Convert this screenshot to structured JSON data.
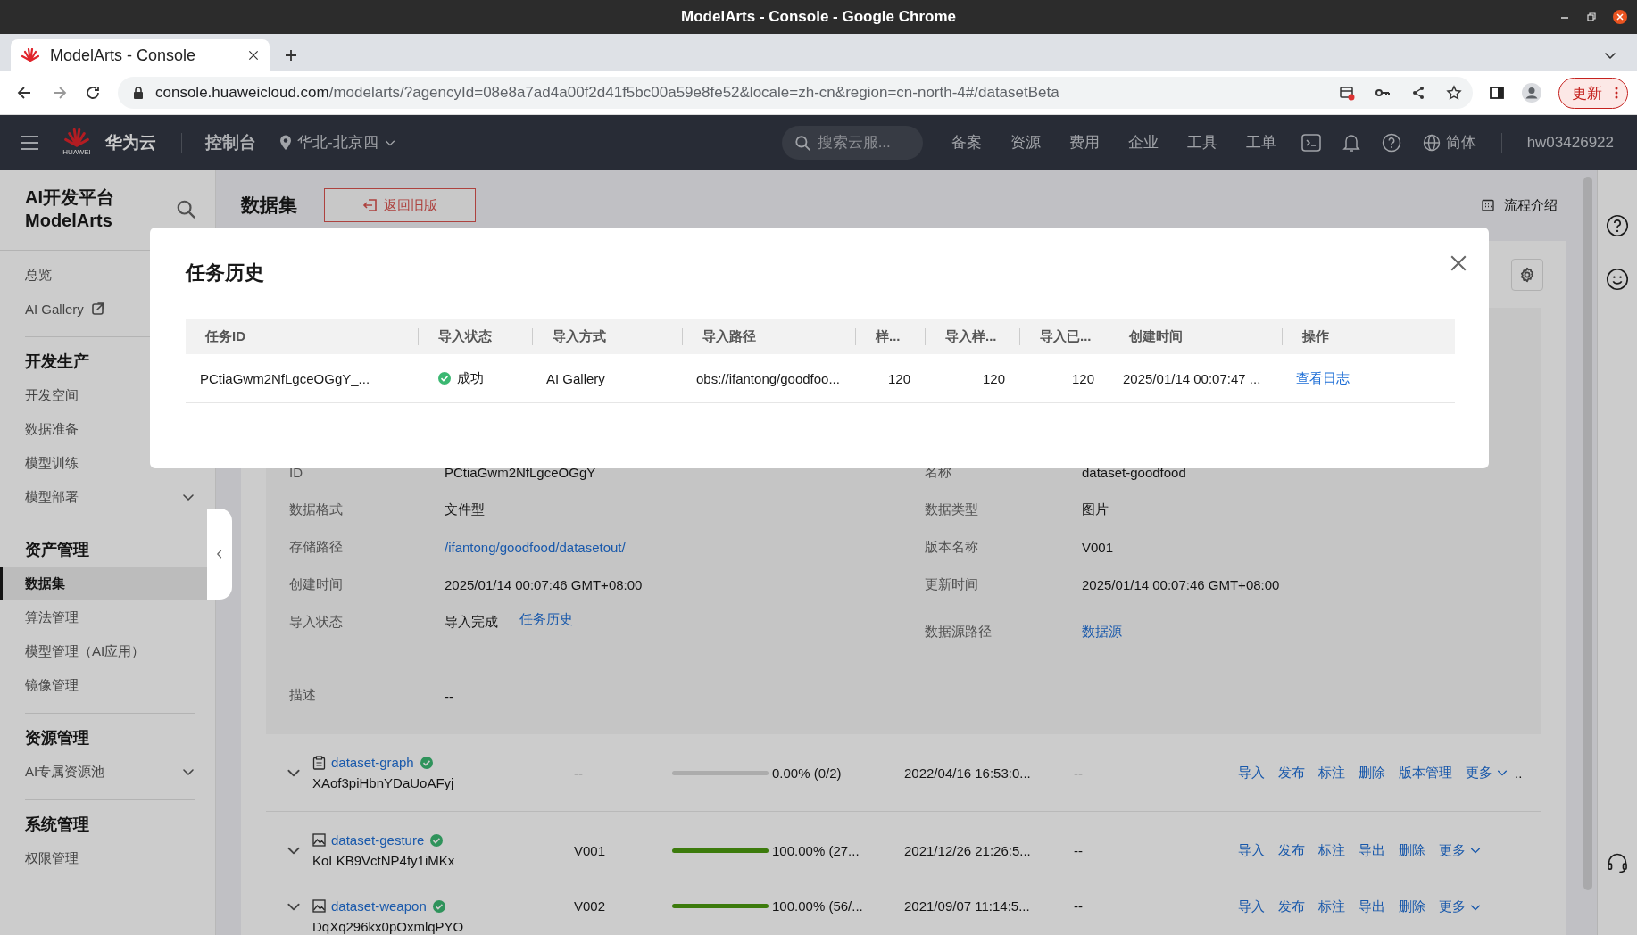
{
  "browser": {
    "title": "ModelArts - Console - Google Chrome",
    "tab_title": "ModelArts - Console",
    "url_host": "console.huaweicloud.com",
    "url_path": "/modelarts/?agencyId=08e8a7ad4a00f2d41f5bc00a59e8fe52&locale=zh-cn&region=cn-north-4#/datasetBeta",
    "update_button": "更新"
  },
  "header": {
    "logo_text": "HUAWEI",
    "brand": "华为云",
    "console": "控制台",
    "region": "华北-北京四",
    "search": {
      "placeholder": "搜索云服..."
    },
    "nav": [
      "备案",
      "资源",
      "费用",
      "企业",
      "工具",
      "工单"
    ],
    "language": "简体",
    "user": "hw03426922"
  },
  "sidebar": {
    "title": [
      "AI开发平台",
      "ModelArts"
    ],
    "groups": [
      {
        "items": [
          {
            "label": "总览",
            "kind": "item",
            "selected": false
          },
          {
            "label": "AI Gallery",
            "kind": "external",
            "selected": false
          }
        ]
      },
      {
        "heading": "开发生产",
        "items": [
          {
            "label": "开发空间",
            "kind": "item",
            "selected": false
          },
          {
            "label": "数据准备",
            "kind": "item",
            "selected": false
          },
          {
            "label": "模型训练",
            "kind": "item",
            "selected": false
          },
          {
            "label": "模型部署",
            "kind": "expandable",
            "selected": false
          }
        ]
      },
      {
        "heading": "资产管理",
        "items": [
          {
            "label": "数据集",
            "kind": "item",
            "selected": true
          },
          {
            "label": "算法管理",
            "kind": "item",
            "selected": false
          },
          {
            "label": "模型管理（AI应用）",
            "kind": "item",
            "selected": false
          },
          {
            "label": "镜像管理",
            "kind": "item",
            "selected": false
          }
        ]
      },
      {
        "heading": "资源管理",
        "items": [
          {
            "label": "AI专属资源池",
            "kind": "expandable",
            "selected": false
          }
        ]
      },
      {
        "heading": "系统管理",
        "items": [
          {
            "label": "权限管理",
            "kind": "item",
            "selected": false
          }
        ]
      }
    ]
  },
  "page": {
    "title": "数据集",
    "back_button": "返回旧版",
    "intro_link": "流程介绍"
  },
  "details": [
    [
      {
        "label": "ID",
        "value": "PCtiaGwm2NfLgceOGgY",
        "kind": "text"
      },
      {
        "label": "名称",
        "value": "dataset-goodfood",
        "kind": "text"
      }
    ],
    [
      {
        "label": "数据格式",
        "value": "文件型",
        "kind": "text"
      },
      {
        "label": "数据类型",
        "value": "图片",
        "kind": "text"
      }
    ],
    [
      {
        "label": "存储路径",
        "value": "/ifantong/goodfood/datasetout/",
        "kind": "link"
      },
      {
        "label": "版本名称",
        "value": "V001",
        "kind": "text"
      }
    ],
    [
      {
        "label": "创建时间",
        "value": "2025/01/14 00:07:46 GMT+08:00",
        "kind": "text"
      },
      {
        "label": "更新时间",
        "value": "2025/01/14 00:07:46 GMT+08:00",
        "kind": "text"
      }
    ],
    [
      {
        "label": "导入状态",
        "value": "导入完成",
        "link": "任务历史",
        "kind": "text"
      },
      {
        "label": "数据源路径",
        "value": "数据源",
        "kind": "link"
      }
    ],
    [
      {
        "label": "描述",
        "value": "--",
        "kind": "text"
      }
    ]
  ],
  "datasets": [
    {
      "name": "dataset-graph",
      "kind": "table",
      "id": "XAof3piHbnYDaUoAFyj",
      "version": "--",
      "level": 0,
      "progress": "0.00% (0/2)",
      "time": "2022/04/16 16:53:0...",
      "column_5": "--",
      "actions": [
        "导入",
        "发布",
        "标注",
        "删除",
        "版本管理"
      ],
      "more": "更多",
      "overflow": ".."
    },
    {
      "name": "dataset-gesture",
      "kind": "image",
      "id": "KoLKB9VctNP4fy1iMKx",
      "version": "V001",
      "level": 1,
      "progress": "100.00% (27...",
      "time": "2021/12/26 21:26:5...",
      "column_5": "--",
      "actions": [
        "导入",
        "发布",
        "标注",
        "导出",
        "删除"
      ],
      "more": "更多"
    },
    {
      "name": "dataset-weapon",
      "kind": "image",
      "id": "DqXq296kx0pOxmlqPYO",
      "version": "V002",
      "level": 1,
      "progress": "100.00% (56/...",
      "time": "2021/09/07 11:14:5...",
      "column_5": "--",
      "actions": [
        "导入",
        "发布",
        "标注",
        "导出",
        "删除"
      ],
      "more": "更多"
    }
  ],
  "modal": {
    "title": "任务历史",
    "columns": [
      "任务ID",
      "导入状态",
      "导入方式",
      "导入路径",
      "样...",
      "导入样...",
      "导入已...",
      "创建时间",
      "操作"
    ],
    "rows": [
      {
        "id": "PCtiaGwm2NfLgceOGgY_...",
        "status": {
          "text": "成功",
          "kind": "success"
        },
        "method": "AI Gallery",
        "path": "obs://ifantong/goodfoo...",
        "column_5": "120",
        "column_6": "120",
        "column_7": "120",
        "created": "2025/01/14 00:07:47 ...",
        "action": "查看日志"
      }
    ]
  }
}
